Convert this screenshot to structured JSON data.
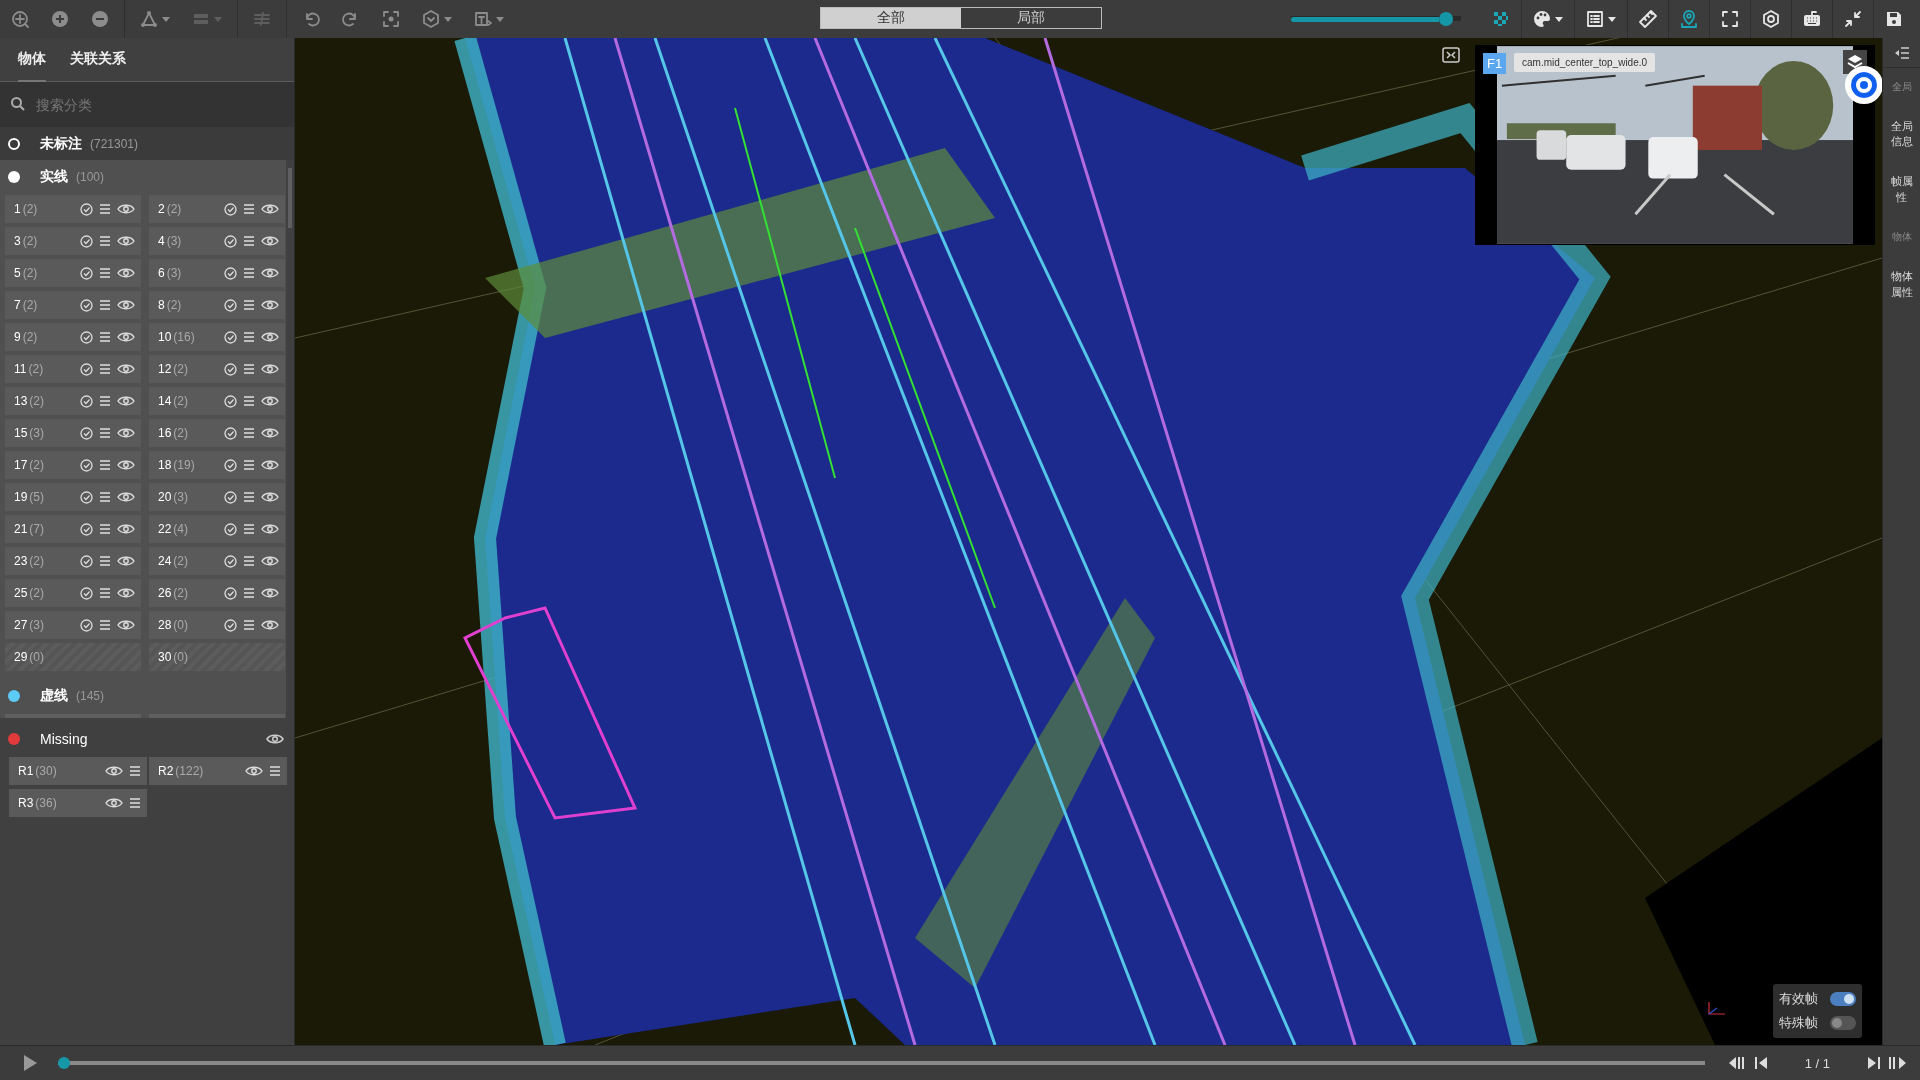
{
  "toolbar": {
    "left_tools": [
      {
        "disabled": false,
        "dropdown": false
      },
      {
        "disabled": false,
        "dropdown": false
      },
      {
        "disabled": false,
        "dropdown": false
      },
      {
        "disabled": false,
        "dropdown": true
      },
      {
        "disabled": true,
        "dropdown": true
      },
      {
        "disabled": true,
        "dropdown": false
      },
      {
        "disabled": false,
        "dropdown": false
      },
      {
        "disabled": false,
        "dropdown": false
      },
      {
        "disabled": false,
        "dropdown": false
      },
      {
        "disabled": false,
        "dropdown": true
      },
      {
        "disabled": false,
        "dropdown": true
      }
    ],
    "view_modes": [
      {
        "label": "全部",
        "selected": true
      },
      {
        "label": "局部",
        "selected": false
      }
    ],
    "right_tools": [
      {
        "active": true,
        "dropdown": false
      },
      {
        "active": false,
        "dropdown": true
      },
      {
        "active": false,
        "dropdown": true
      },
      {
        "active": false,
        "dropdown": false
      },
      {
        "active": true,
        "dropdown": false
      },
      {
        "active": false,
        "dropdown": false
      },
      {
        "active": false,
        "dropdown": false
      },
      {
        "active": false,
        "dropdown": false
      },
      {
        "active": false,
        "dropdown": false
      },
      {
        "active": false,
        "dropdown": false
      }
    ]
  },
  "sidebar": {
    "tabs": [
      {
        "label": "物体",
        "selected": true
      },
      {
        "label": "关联关系",
        "selected": false
      }
    ],
    "search": {
      "placeholder": "搜索分类"
    },
    "categories": [
      {
        "kind": "unlabeled",
        "name": "未标注",
        "count": "(721301)",
        "color": "#ffffff",
        "expanded": false
      },
      {
        "kind": "class",
        "name": "实线",
        "count": "(100)",
        "color": "#ffffff",
        "expanded": true,
        "items": [
          {
            "label": "1",
            "count": "(2)",
            "disabled": false
          },
          {
            "label": "2",
            "count": "(2)",
            "disabled": false
          },
          {
            "label": "3",
            "count": "(2)",
            "disabled": false
          },
          {
            "label": "4",
            "count": "(3)",
            "disabled": false
          },
          {
            "label": "5",
            "count": "(2)",
            "disabled": false
          },
          {
            "label": "6",
            "count": "(3)",
            "disabled": false
          },
          {
            "label": "7",
            "count": "(2)",
            "disabled": false
          },
          {
            "label": "8",
            "count": "(2)",
            "disabled": false
          },
          {
            "label": "9",
            "count": "(2)",
            "disabled": false
          },
          {
            "label": "10",
            "count": "(16)",
            "disabled": false
          },
          {
            "label": "11",
            "count": "(2)",
            "disabled": false
          },
          {
            "label": "12",
            "count": "(2)",
            "disabled": false
          },
          {
            "label": "13",
            "count": "(2)",
            "disabled": false
          },
          {
            "label": "14",
            "count": "(2)",
            "disabled": false
          },
          {
            "label": "15",
            "count": "(3)",
            "disabled": false
          },
          {
            "label": "16",
            "count": "(2)",
            "disabled": false
          },
          {
            "label": "17",
            "count": "(2)",
            "disabled": false
          },
          {
            "label": "18",
            "count": "(19)",
            "disabled": false
          },
          {
            "label": "19",
            "count": "(5)",
            "disabled": false
          },
          {
            "label": "20",
            "count": "(3)",
            "disabled": false
          },
          {
            "label": "21",
            "count": "(7)",
            "disabled": false
          },
          {
            "label": "22",
            "count": "(4)",
            "disabled": false
          },
          {
            "label": "23",
            "count": "(2)",
            "disabled": false
          },
          {
            "label": "24",
            "count": "(2)",
            "disabled": false
          },
          {
            "label": "25",
            "count": "(2)",
            "disabled": false
          },
          {
            "label": "26",
            "count": "(2)",
            "disabled": false
          },
          {
            "label": "27",
            "count": "(3)",
            "disabled": false
          },
          {
            "label": "28",
            "count": "(0)",
            "disabled": false
          },
          {
            "label": "29",
            "count": "(0)",
            "disabled": true
          },
          {
            "label": "30",
            "count": "(0)",
            "disabled": true
          }
        ]
      },
      {
        "kind": "class",
        "name": "虚线",
        "count": "(145)",
        "color": "#5ccbf5",
        "expanded": true
      },
      {
        "kind": "missing",
        "name": "Missing",
        "color": "#e03a3a",
        "expanded": true,
        "items": [
          {
            "label": "R1",
            "count": "(30)",
            "disabled": false
          },
          {
            "label": "R2",
            "count": "(122)",
            "disabled": false
          },
          {
            "label": "R3",
            "count": "(36)",
            "disabled": false
          }
        ]
      }
    ]
  },
  "viewport": {
    "kind": "picture",
    "camera": {
      "badge": "F1",
      "name": "cam.mid_center_top_wide.0"
    },
    "toggles": [
      {
        "label": "有效帧",
        "on": true
      },
      {
        "label": "特殊帧",
        "on": false
      }
    ]
  },
  "right_panel": {
    "items": [
      {
        "label": "全局",
        "disabled": true
      },
      {
        "label": "全局信息",
        "disabled": false
      },
      {
        "label": "帧属性",
        "disabled": false
      },
      {
        "label": "物体",
        "disabled": true
      },
      {
        "label": "物体属性",
        "disabled": false
      }
    ]
  },
  "playback": {
    "progress": {
      "level": 0
    },
    "frame": "1 / 1"
  }
}
